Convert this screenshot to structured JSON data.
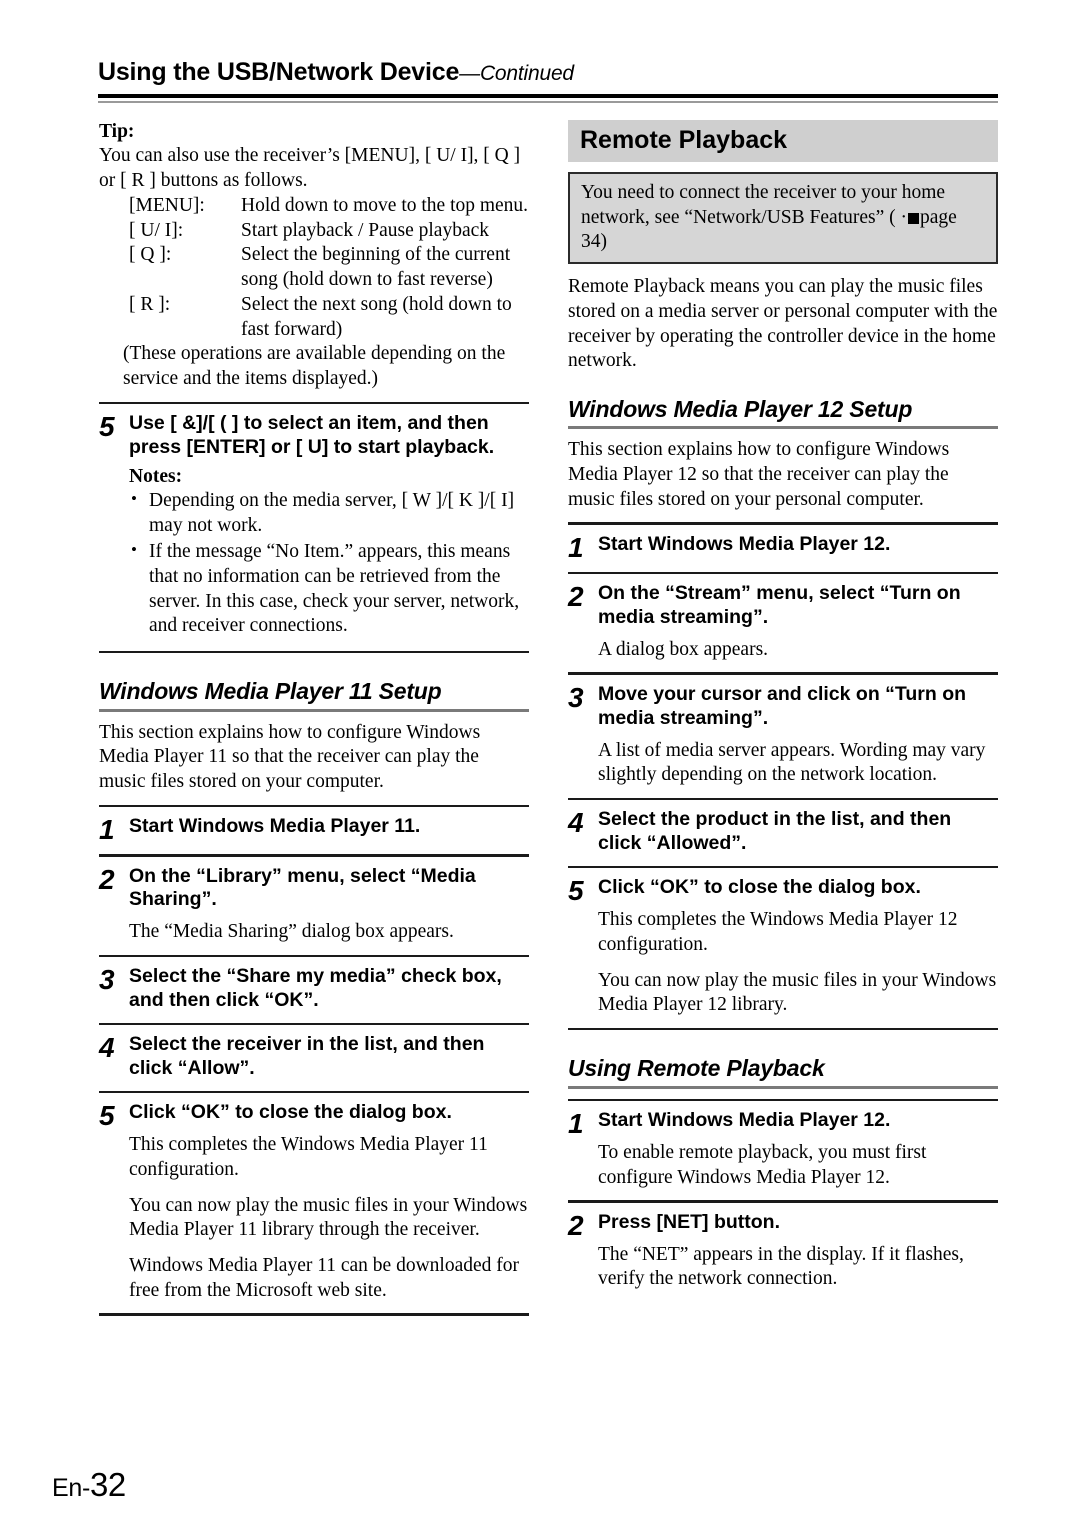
{
  "header": {
    "title": "Using the USB/Network Device",
    "continued": "—Continued"
  },
  "footer": {
    "lang_prefix": "En-",
    "page_number": "32"
  },
  "left_column": {
    "tip": {
      "label": "Tip:",
      "lead_line1": "You can also use the receiver’s [MENU], [ U/ I], [ Q    ]",
      "lead_line2": "or [ R    ] buttons as follows.",
      "rows": [
        {
          "key": "[MENU]:",
          "value": "Hold down to move to the top menu."
        },
        {
          "key": "[ U/ I]:",
          "value": "Start playback / Pause playback"
        },
        {
          "key": "[ Q    ]:",
          "value": "Select the beginning of the current song (hold down to fast reverse)"
        },
        {
          "key": "[ R    ]:",
          "value": "Select the next song (hold down to fast forward)"
        }
      ],
      "closing": "(These operations are available depending on the service and the items displayed.)"
    },
    "step5": {
      "number": "5",
      "title": "Use [ &]/[ ( ] to select an item, and then press [ENTER] or [ U] to start playback.",
      "notes_label": "Notes:",
      "notes": [
        "Depending on the media server, [ W   ]/[ K    ]/[ I] may not work.",
        "If the message “No Item.” appears, this means that no information can be retrieved from the server. In this case, check your server, network, and receiver connections."
      ]
    },
    "wmp11": {
      "heading": "Windows Media Player 11 Setup",
      "intro": "This section explains how to configure Windows Media Player 11 so that the receiver can play the music files stored on your computer.",
      "steps": [
        {
          "number": "1",
          "title": "Start Windows Media Player 11.",
          "notes": []
        },
        {
          "number": "2",
          "title": "On the “Library” menu, select “Media Sharing”.",
          "notes": [
            "The “Media Sharing” dialog box appears."
          ]
        },
        {
          "number": "3",
          "title": "Select the “Share my media” check box, and then click “OK”.",
          "notes": []
        },
        {
          "number": "4",
          "title": "Select the receiver in the list, and then click “Allow”.",
          "notes": []
        },
        {
          "number": "5",
          "title": "Click “OK” to close the dialog box.",
          "notes": [
            "This completes the Windows Media Player 11 configuration.",
            "You can now play the music files in your Windows Media Player 11 library through the receiver.",
            "Windows Media Player 11 can be downloaded for free from the Microsoft web site."
          ]
        }
      ]
    }
  },
  "right_column": {
    "chapter": {
      "title": "Remote Playback"
    },
    "note_box": {
      "line1": "You need to connect the receiver to your home",
      "line2_pre": "network, see “Network/USB Features” ( ·",
      "line2_post": "page 34)"
    },
    "intro": "Remote Playback means you can play the music files stored on a media server or personal computer with the receiver by operating the controller device in the home network.",
    "wmp12": {
      "heading": "Windows Media Player 12 Setup",
      "intro": "This section explains how to configure Windows Media Player 12 so that the receiver can play the music files stored on your personal computer.",
      "steps": [
        {
          "number": "1",
          "title": "Start Windows Media Player 12.",
          "notes": []
        },
        {
          "number": "2",
          "title": "On the “Stream” menu, select “Turn on media streaming”.",
          "notes": [
            "A dialog box appears."
          ]
        },
        {
          "number": "3",
          "title": "Move your cursor and click on “Turn on media streaming”.",
          "notes": [
            "A list of media server appears. Wording may vary slightly depending on the network location."
          ]
        },
        {
          "number": "4",
          "title": "Select the product in the list, and then click “Allowed”.",
          "notes": []
        },
        {
          "number": "5",
          "title": "Click “OK” to close the dialog box.",
          "notes": [
            "This completes the Windows Media Player 12 configuration.",
            "You can now play the music files in your Windows Media Player 12 library."
          ]
        }
      ]
    },
    "using_remote": {
      "heading": "Using Remote Playback",
      "steps": [
        {
          "number": "1",
          "title": "Start Windows Media Player 12.",
          "notes": [
            "To enable remote playback, you must first configure Windows Media Player 12."
          ]
        },
        {
          "number": "2",
          "title": "Press [NET] button.",
          "notes": [
            "The “NET” appears in the display. If it flashes, verify the network connection."
          ]
        }
      ]
    }
  }
}
